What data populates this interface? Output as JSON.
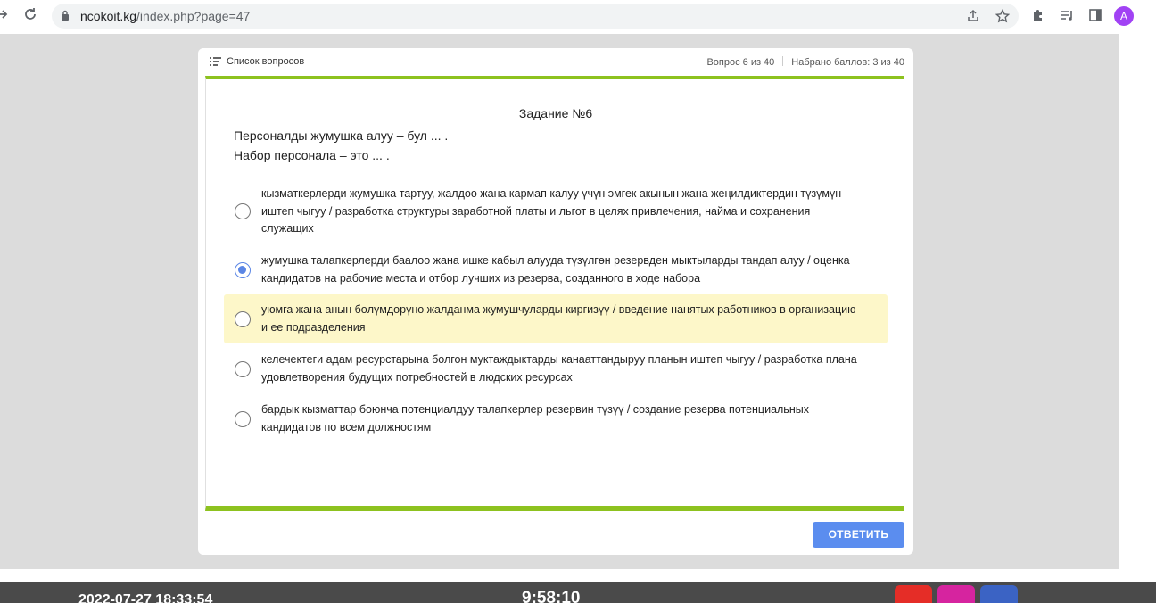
{
  "browser": {
    "url_host": "ncokoit.kg",
    "url_path": "/index.php?page=47",
    "avatar_letter": "A"
  },
  "quiz": {
    "question_list_label": "Список вопросов",
    "progress": "Вопрос 6 из 40",
    "score": "Набрано баллов: 3 из 40",
    "task_title": "Задание №6",
    "question_ky": "Персоналды жумушка алуу – бул ... .",
    "question_ru": "Набор персонала – это ... .",
    "options": [
      {
        "text": "кызматкерлерди жумушка тартуу, жалдоо жана кармап калуу үчүн эмгек акынын жана жеңилдиктердин түзүмүн иштеп чыгуу  / разработка структуры заработной платы и льгот в целях привлечения, найма и сохранения служащих",
        "selected": false
      },
      {
        "text": "жумушка талапкерлерди баалоо жана ишке кабыл алууда түзүлгөн резервден мыктыларды тандап алуу / оценка кандидатов на рабочие места и отбор лучших из резерва, созданного в ходе набора",
        "selected": true
      },
      {
        "text": "уюмга жана анын бөлүмдөрүнө жалданма жумушчуларды киргизүү  / введение нанятых работников в организацию и ее подразделения",
        "selected": false
      },
      {
        "text": "келечектеги адам ресурстарына болгон муктаждыктарды канааттандыруу планын иштеп чыгуу  / разработка плана удовлетворения будущих потребностей в людских ресурсах",
        "selected": false
      },
      {
        "text": "бардык кызматтар боюнча потенциалдуу талапкерлер резервин түзүү  / создание резерва потенциальных кандидатов по всем должностям",
        "selected": false
      }
    ],
    "answer_button": "ОТВЕТИТЬ"
  },
  "footer": {
    "datetime": "2022-07-27 18:33:54",
    "timer": "9:58:10"
  },
  "colors": {
    "accent_green": "#8dc21f",
    "button_blue": "#5b8def",
    "highlight": "#fdf7c9"
  }
}
